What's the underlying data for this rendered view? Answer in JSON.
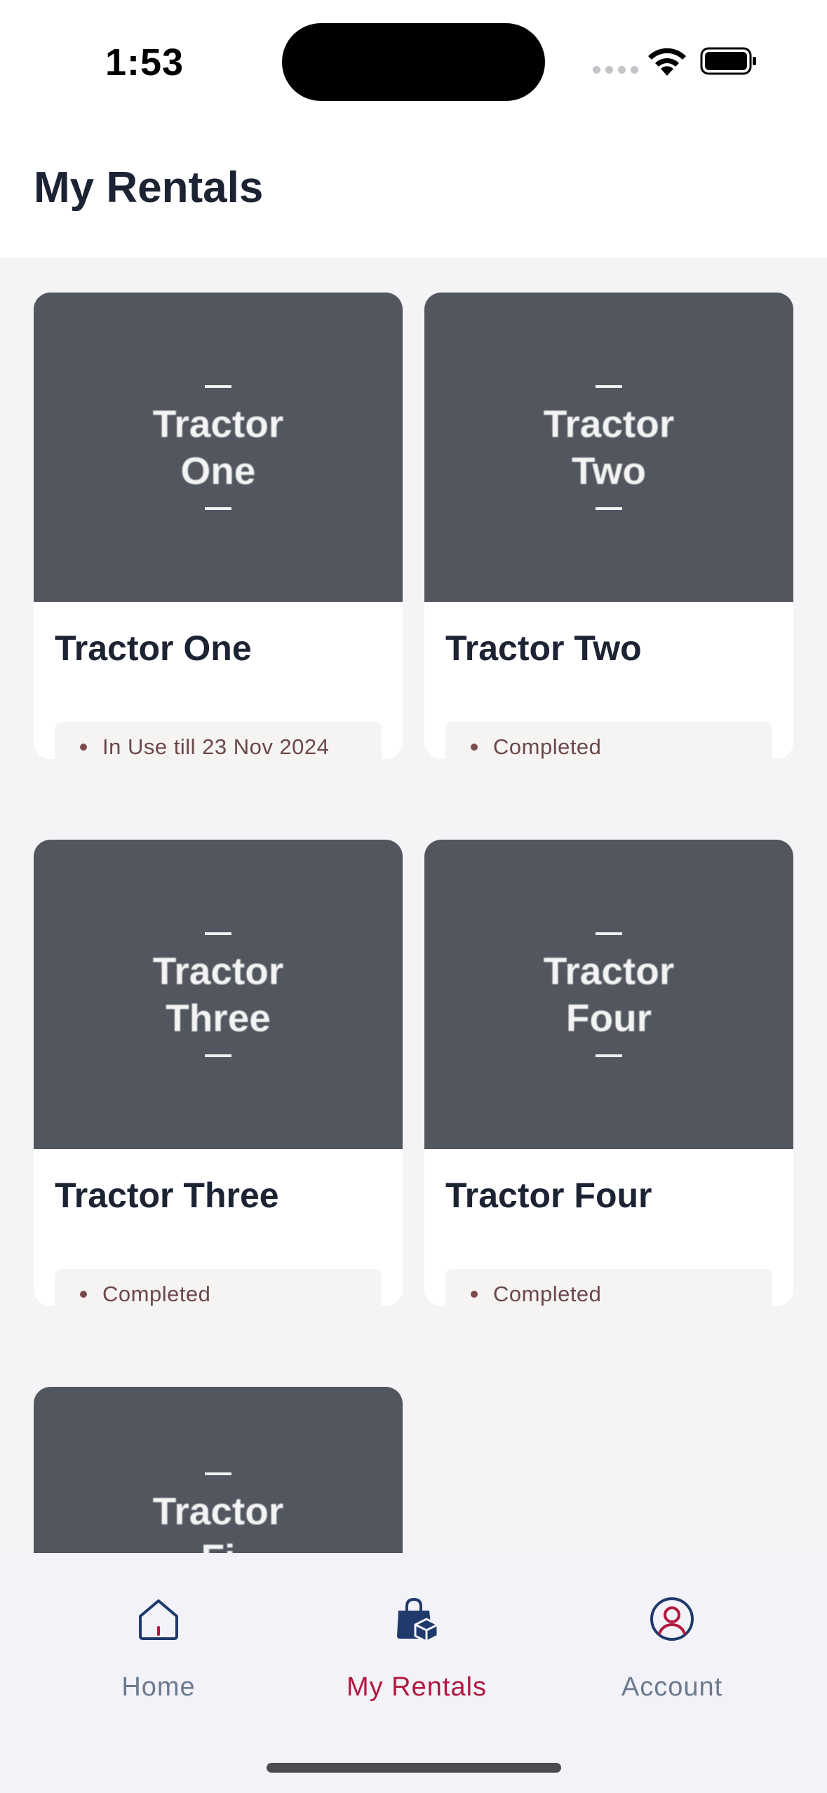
{
  "status_bar": {
    "time": "1:53"
  },
  "header": {
    "title": "My Rentals"
  },
  "rentals": [
    {
      "image_text": "Tractor\nOne",
      "name": "Tractor One",
      "status": "In Use till 23 Nov 2024"
    },
    {
      "image_text": "Tractor\nTwo",
      "name": "Tractor Two",
      "status": "Completed"
    },
    {
      "image_text": "Tractor\nThree",
      "name": "Tractor Three",
      "status": "Completed"
    },
    {
      "image_text": "Tractor\nFour",
      "name": "Tractor Four",
      "status": "Completed"
    },
    {
      "image_text": "Tractor\nFi",
      "name": "",
      "status": ""
    }
  ],
  "nav": {
    "home": {
      "label": "Home",
      "icon": "home-icon"
    },
    "rentals": {
      "label": "My Rentals",
      "icon": "rentals-bag-icon",
      "active": true
    },
    "account": {
      "label": "Account",
      "icon": "account-icon"
    }
  },
  "colors": {
    "accent": "#b3173e",
    "nav_inactive": "#6b7a90",
    "rentals_icon": "#1f3a6b",
    "thumb_bg": "#52565f",
    "badge_bg": "#f6f3f3"
  }
}
